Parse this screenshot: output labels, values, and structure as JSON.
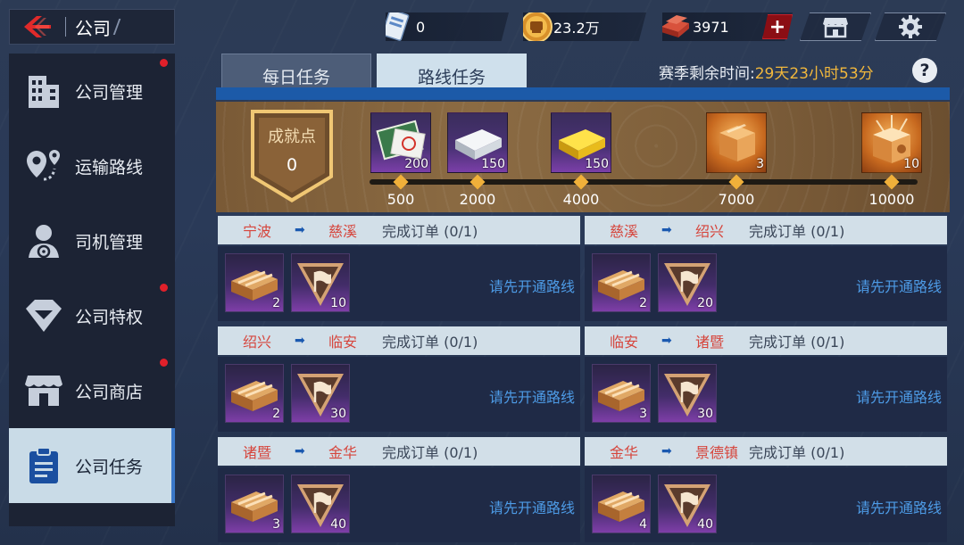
{
  "header": {
    "title": "公司",
    "resources": {
      "ticket": "0",
      "gold": "23.2万",
      "brick": "3971"
    },
    "plus_label": "+"
  },
  "sidebar": {
    "items": [
      {
        "label": "公司管理",
        "icon": "building-icon",
        "badge": true
      },
      {
        "label": "运输路线",
        "icon": "route-pin-icon",
        "badge": false
      },
      {
        "label": "司机管理",
        "icon": "driver-icon",
        "badge": false
      },
      {
        "label": "公司特权",
        "icon": "diamond-icon",
        "badge": true
      },
      {
        "label": "公司商店",
        "icon": "store-icon",
        "badge": true
      },
      {
        "label": "公司任务",
        "icon": "clipboard-icon",
        "badge": false,
        "active": true
      }
    ]
  },
  "tabs": [
    {
      "label": "每日任务",
      "active": false
    },
    {
      "label": "路线任务",
      "active": true
    }
  ],
  "season": {
    "label": "赛季剩余时间:",
    "value": "29天23小时53分",
    "help": "?"
  },
  "achievement": {
    "title": "成就点",
    "value": "0",
    "rewards": [
      {
        "count": "200",
        "icon": "map-voucher-icon",
        "milestone": "500"
      },
      {
        "count": "150",
        "icon": "silver-bar-icon",
        "milestone": "2000"
      },
      {
        "count": "150",
        "icon": "gold-bar-icon",
        "milestone": "4000"
      },
      {
        "count": "3",
        "icon": "gift-box-icon",
        "milestone": "7000"
      },
      {
        "count": "10",
        "icon": "gift-box-open-icon",
        "milestone": "10000"
      }
    ]
  },
  "routes": [
    {
      "from": "宁波",
      "to": "慈溪",
      "task": "完成订单 (0/1)",
      "item1": "2",
      "item2": "10",
      "hint": "请先开通路线"
    },
    {
      "from": "慈溪",
      "to": "绍兴",
      "task": "完成订单 (0/1)",
      "item1": "2",
      "item2": "20",
      "hint": "请先开通路线"
    },
    {
      "from": "绍兴",
      "to": "临安",
      "task": "完成订单 (0/1)",
      "item1": "2",
      "item2": "30",
      "hint": "请先开通路线"
    },
    {
      "from": "临安",
      "to": "诸暨",
      "task": "完成订单 (0/1)",
      "item1": "3",
      "item2": "30",
      "hint": "请先开通路线"
    },
    {
      "from": "诸暨",
      "to": "金华",
      "task": "完成订单 (0/1)",
      "item1": "3",
      "item2": "40",
      "hint": "请先开通路线"
    },
    {
      "from": "金华",
      "to": "景德镇",
      "task": "完成订单 (0/1)",
      "item1": "4",
      "item2": "40",
      "hint": "请先开通路线"
    }
  ],
  "colors": {
    "accent_blue": "#1c5aa8",
    "badge_red": "#e0202a",
    "season_gold": "#f1b73c",
    "city_red": "#d6453c",
    "hint_blue": "#4d9be6"
  }
}
